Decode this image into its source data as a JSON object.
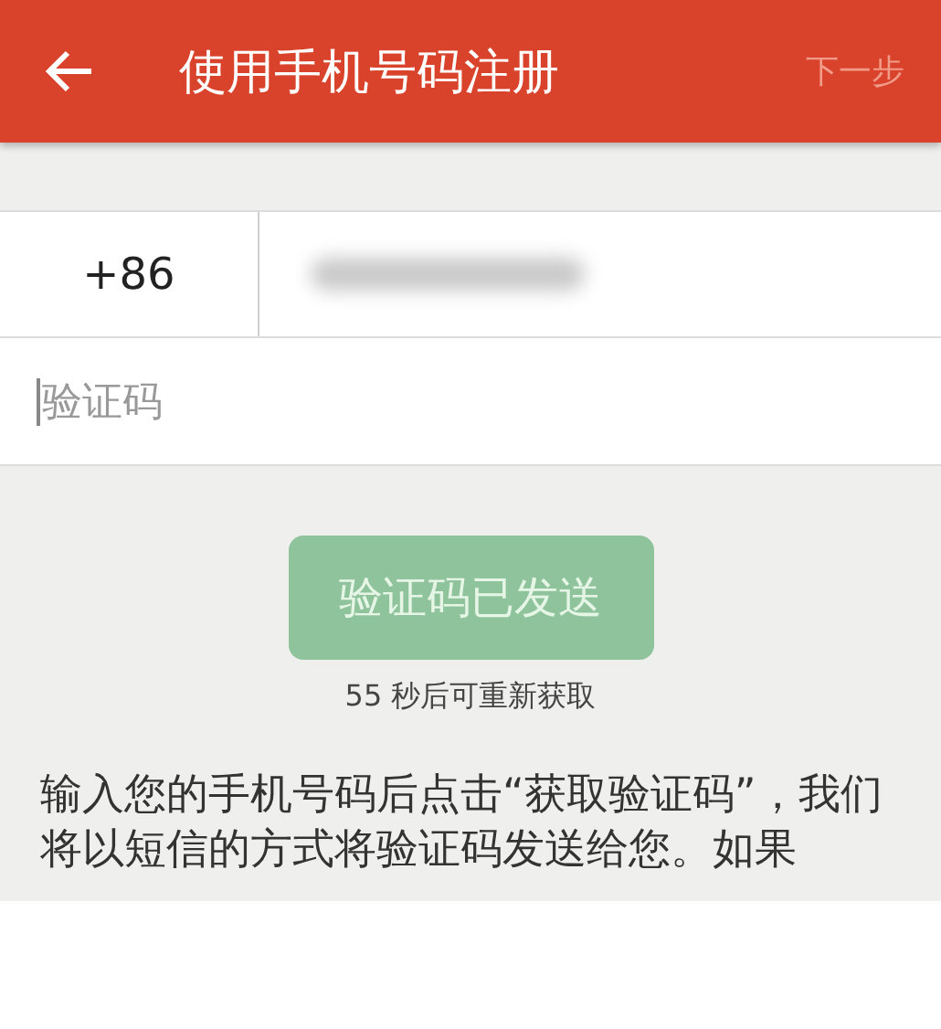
{
  "header": {
    "title": "使用手机号码注册",
    "next": {
      "label": "下一步",
      "disabled": true
    }
  },
  "phone": {
    "country_code": "+86",
    "number_redacted": true
  },
  "code_field": {
    "placeholder": "验证码",
    "focused": true
  },
  "send_button": {
    "label": "验证码已发送",
    "disabled": true
  },
  "countdown": "55 秒后可重新获取",
  "instructions": "输入您的手机号码后点击“获取验证码”，我们将以短信的方式将验证码发送给您。如果"
}
